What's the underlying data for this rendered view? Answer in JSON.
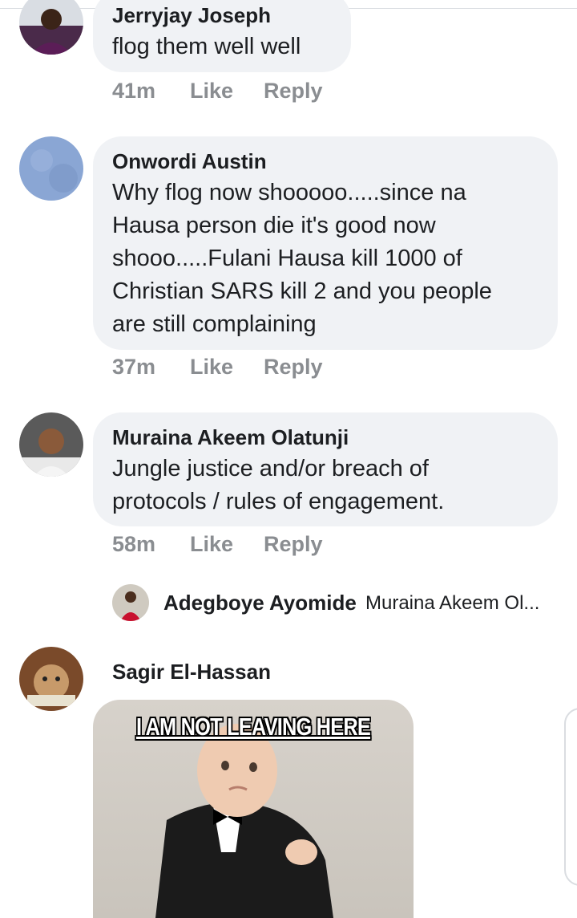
{
  "comments": [
    {
      "author": "Jerryjay Joseph",
      "lines": [
        "flog them well well"
      ],
      "time": "41m",
      "like_label": "Like",
      "reply_label": "Reply"
    },
    {
      "author": "Onwordi Austin",
      "lines": [
        "Why flog now shooooo.....since na",
        "Hausa person die it's good now",
        "shooo.....Fulani Hausa kill 1000 of",
        "Christian SARS kill 2 and you people",
        "are still complaining"
      ],
      "time": "37m",
      "like_label": "Like",
      "reply_label": "Reply"
    },
    {
      "author": "Muraina Akeem Olatunji",
      "lines": [
        "Jungle justice and/or breach of",
        "protocols / rules of engagement."
      ],
      "time": "58m",
      "like_label": "Like",
      "reply_label": "Reply",
      "reply_preview": {
        "author": "Adegboye Ayomide",
        "text": "Muraina Akeem Ol..."
      }
    },
    {
      "author": "Sagir El-Hassan",
      "meme_caption": "I AM NOT LEAVING HERE"
    }
  ]
}
